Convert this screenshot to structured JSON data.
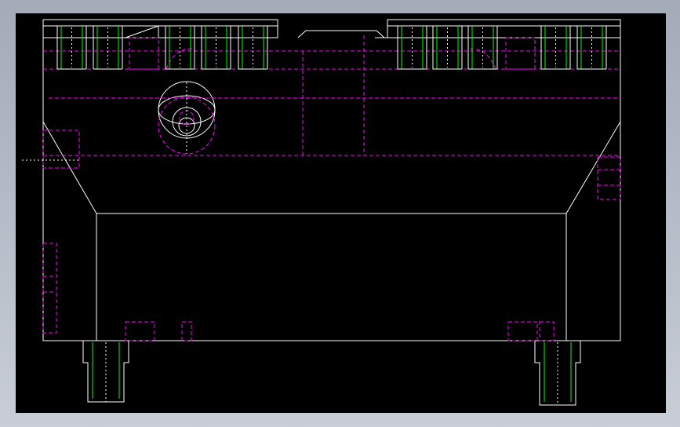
{
  "viewer": {
    "background": "#000000",
    "frame_color": "#bcc3cf"
  },
  "drawing": {
    "subject": "",
    "line_colors": {
      "outline": "#ffffff",
      "hidden": "#ff00ff",
      "thread": "#00ff00",
      "centerline": "#ffffff"
    }
  }
}
